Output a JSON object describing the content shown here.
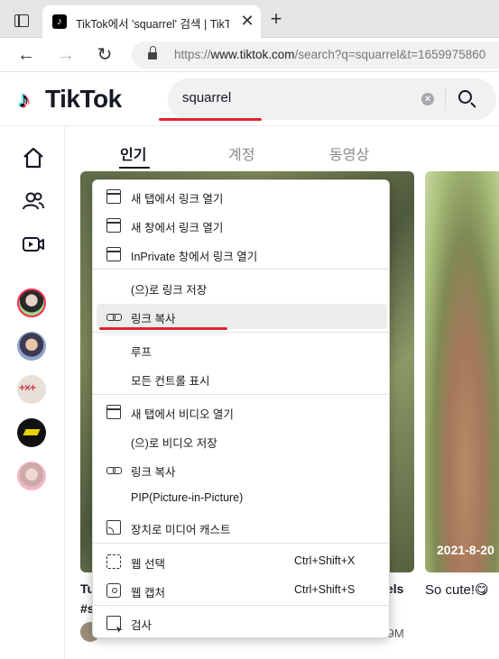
{
  "browser": {
    "tab": {
      "title": "TikTok에서 'squarrel' 검색 | TikTok",
      "close": "✕"
    },
    "new_tab": "+",
    "nav": {
      "back": "←",
      "forward": "→",
      "reload": "↻"
    },
    "url": {
      "scheme": "https://",
      "host": "www.tiktok.com",
      "path": "/search?q=squarrel&t=1659975860"
    }
  },
  "tiktok": {
    "logo_text": "TikTok",
    "search": {
      "value": "squarrel"
    },
    "tabs": [
      {
        "label": "인기",
        "active": true
      },
      {
        "label": "계정",
        "active": false
      },
      {
        "label": "동영상",
        "active": false
      }
    ],
    "sidebar": {
      "icons": [
        "home-icon",
        "following-icon",
        "live-icon"
      ],
      "avatars": [
        "avatar-1",
        "avatar-2",
        "avatar-3",
        "avatar-4",
        "avatar-5"
      ]
    },
    "cards": [
      {
        "caption_start": "Tu",
        "caption_line2": "#s",
        "caption_end": "els",
        "views": ".9M"
      },
      {
        "date_overlay": "2021-8-20",
        "caption": "So cute!😋"
      }
    ]
  },
  "context_menu": {
    "items": [
      {
        "icon": "new-tab-icon",
        "label": "새 탭에서 링크 열기"
      },
      {
        "icon": "new-window-icon",
        "label": "새 창에서 링크 열기"
      },
      {
        "icon": "inprivate-icon",
        "label": "InPrivate 창에서 링크 열기"
      },
      {
        "icon": "",
        "label": "(으)로 링크 저장"
      },
      {
        "icon": "link-icon",
        "label": "링크 복사",
        "highlighted": true
      },
      {
        "icon": "",
        "label": "루프"
      },
      {
        "icon": "",
        "label": "모든 컨트롤 표시"
      },
      {
        "icon": "new-tab-icon",
        "label": "새 탭에서 비디오 열기"
      },
      {
        "icon": "",
        "label": "(으)로 비디오 저장"
      },
      {
        "icon": "link-icon",
        "label": "링크 복사"
      },
      {
        "icon": "",
        "label": "PIP(Picture-in-Picture)"
      },
      {
        "icon": "cast-icon",
        "label": "장치로 미디어 캐스트"
      },
      {
        "icon": "web-select-icon",
        "label": "웹 선택",
        "shortcut": "Ctrl+Shift+X"
      },
      {
        "icon": "web-capture-icon",
        "label": "웹 캡처",
        "shortcut": "Ctrl+Shift+S"
      },
      {
        "icon": "inspect-icon",
        "label": "검사"
      }
    ]
  },
  "colors": {
    "accent_red": "#e0262f",
    "menu_highlight": "#ececec",
    "tiktok_cyan": "#25f4ee",
    "tiktok_pink": "#fe2c55"
  }
}
